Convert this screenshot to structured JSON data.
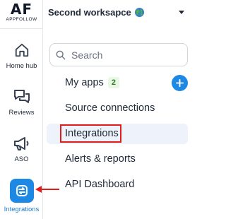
{
  "brand": {
    "mark": "AF",
    "name": "APPFOLLOW"
  },
  "workspace": {
    "name": "Second worksapce",
    "globe_icon": "globe-icon"
  },
  "rail": {
    "items": [
      {
        "label": "Home hub",
        "icon": "home-icon"
      },
      {
        "label": "Reviews",
        "icon": "chat-bubbles-icon"
      },
      {
        "label": "ASO",
        "icon": "megaphone-icon"
      },
      {
        "label": "Integrations",
        "icon": "integrations-icon",
        "active": true
      }
    ]
  },
  "search": {
    "placeholder": "Search"
  },
  "menu": {
    "my_apps": {
      "label": "My apps",
      "count": "2"
    },
    "items": [
      {
        "label": "Source connections"
      },
      {
        "label": "Integrations",
        "highlighted": true
      },
      {
        "label": "Alerts & reports"
      },
      {
        "label": "API Dashboard"
      }
    ]
  },
  "colors": {
    "accent": "#1e88e5",
    "active_label": "#1d7bd1",
    "highlight_box": "#e21b1b",
    "badge_bg": "#eaf7e4",
    "badge_text": "#2e7d32",
    "row_highlight": "#eef3fb"
  }
}
